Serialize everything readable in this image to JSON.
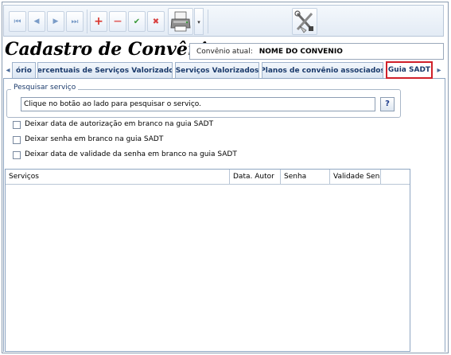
{
  "toolbar": {
    "buttons": [
      {
        "name": "first-record-button",
        "icon": "first-icon",
        "glyph": "⏮"
      },
      {
        "name": "previous-record-button",
        "icon": "previous-icon",
        "glyph": "◀"
      },
      {
        "name": "next-record-button",
        "icon": "next-icon",
        "glyph": "▶"
      },
      {
        "name": "last-record-button",
        "icon": "last-icon",
        "glyph": "⏭"
      },
      {
        "name": "add-button",
        "icon": "plus-icon",
        "glyph": "+"
      },
      {
        "name": "delete-button",
        "icon": "minus-icon",
        "glyph": "−"
      },
      {
        "name": "confirm-button",
        "icon": "check-icon",
        "glyph": "✔"
      },
      {
        "name": "cancel-button",
        "icon": "x-icon",
        "glyph": "✖"
      }
    ],
    "print_icon": "printer-icon",
    "dropdown_arrow": "▾",
    "tools_icon": "tools-icon"
  },
  "title": "Cadastro de Convênios",
  "convenio": {
    "label": "Convênio atual:",
    "value": "NOME DO CONVENIO"
  },
  "tabs": [
    {
      "label": "ório",
      "active": false
    },
    {
      "label": "Percentuais de Serviços Valorizados",
      "active": false
    },
    {
      "label": "Serviços Valorizados",
      "active": false
    },
    {
      "label": "Planos de convênio associados",
      "active": false
    },
    {
      "label": "Guia SADT",
      "active": true
    }
  ],
  "tab_nav": {
    "left": "◂",
    "right": "▸"
  },
  "search": {
    "legend": "Pesquisar serviço",
    "value": "Clique no botão ao lado para pesquisar o serviço.",
    "help_label": "?"
  },
  "checkboxes": [
    {
      "label": "Deixar data de autorização em branco na guia SADT",
      "checked": false
    },
    {
      "label": "Deixar senha em branco na guia SADT",
      "checked": false
    },
    {
      "label": "Deixar data de validade da senha em branco na guia SADT",
      "checked": false
    }
  ],
  "grid": {
    "columns": [
      "Serviços",
      "Data. Autor",
      "Senha",
      "Validade Senh"
    ],
    "rows": []
  },
  "colors": {
    "tab_text": "#1a3a6b",
    "active_tab_border": "#d0202a",
    "add_icon": "#d8332a",
    "delete_icon": "#e06060",
    "confirm_icon": "#3a9a3a",
    "cancel_icon": "#d84040",
    "nav_icon": "#7a9cc8"
  }
}
